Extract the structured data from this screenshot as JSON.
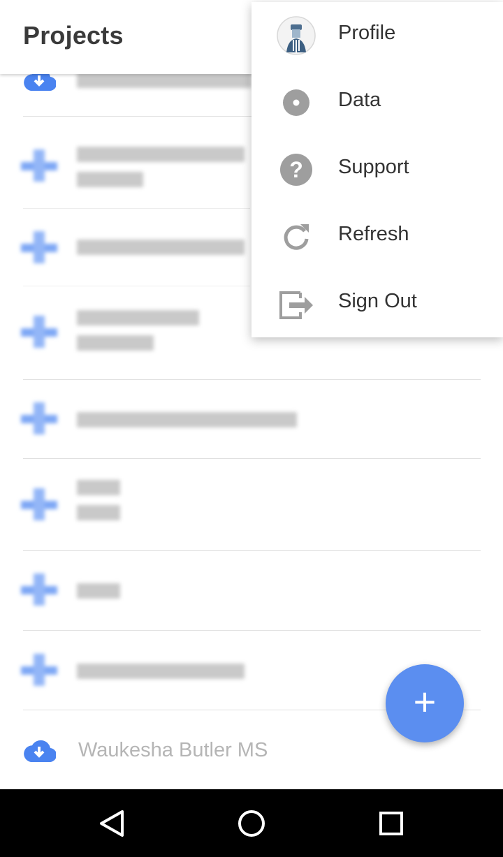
{
  "app_bar": {
    "title": "Projects"
  },
  "menu": {
    "items": [
      {
        "label": "Profile",
        "icon": "avatar"
      },
      {
        "label": "Data",
        "icon": "data-disc-icon"
      },
      {
        "label": "Support",
        "icon": "help-icon"
      },
      {
        "label": "Refresh",
        "icon": "refresh-icon"
      },
      {
        "label": "Sign Out",
        "icon": "sign-out-icon"
      }
    ]
  },
  "projects": {
    "visible_item": {
      "label": "Waukesha Butler MS",
      "icon": "cloud-download-icon"
    }
  },
  "fab": {
    "label": "+"
  },
  "colors": {
    "accent": "#5b8ef0",
    "cloud_icon": "#4a83f0",
    "text_primary": "#333333",
    "text_muted": "#b5b5b5"
  }
}
